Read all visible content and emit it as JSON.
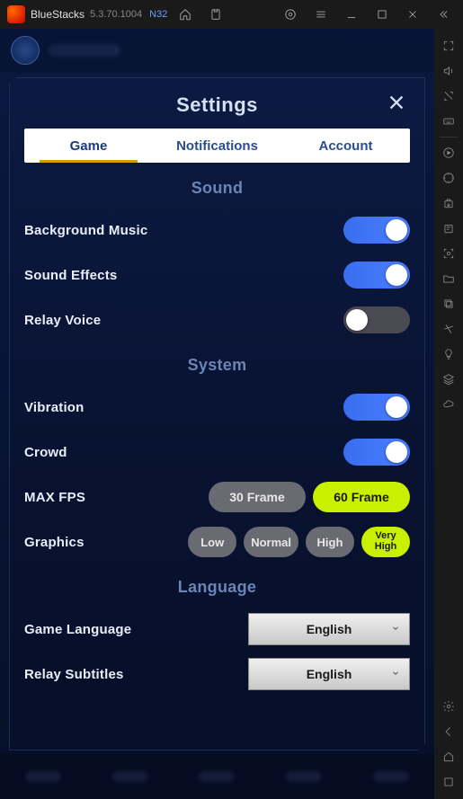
{
  "titlebar": {
    "app_name": "BlueStacks",
    "version": "5.3.70.1004",
    "edition": "N32"
  },
  "modal": {
    "title": "Settings"
  },
  "tabs": {
    "game": "Game",
    "notifications": "Notifications",
    "account": "Account"
  },
  "sections": {
    "sound": "Sound",
    "system": "System",
    "language": "Language"
  },
  "sound": {
    "bgm_label": "Background Music",
    "bgm_on": true,
    "sfx_label": "Sound Effects",
    "sfx_on": true,
    "relay_label": "Relay Voice",
    "relay_on": false
  },
  "system": {
    "vibration_label": "Vibration",
    "vibration_on": true,
    "crowd_label": "Crowd",
    "crowd_on": true,
    "fps_label": "MAX FPS",
    "fps_options": {
      "opt30": "30 Frame",
      "opt60": "60 Frame"
    },
    "graphics_label": "Graphics",
    "graphics_options": {
      "low": "Low",
      "normal": "Normal",
      "high": "High",
      "veryhigh": "Very High"
    }
  },
  "language": {
    "game_label": "Game Language",
    "game_value": "English",
    "subs_label": "Relay Subtitles",
    "subs_value": "English"
  }
}
